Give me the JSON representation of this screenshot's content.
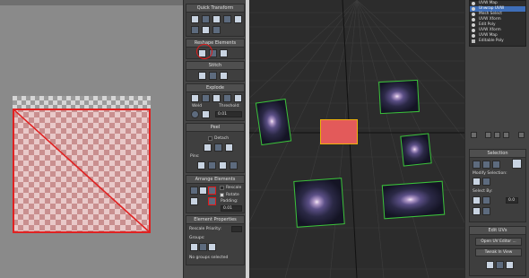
{
  "uv_editor": {
    "quick_transform": {
      "title": "Quick Transform"
    },
    "reshape_elements": {
      "title": "Reshape Elements"
    },
    "stitch": {
      "title": "Stitch"
    },
    "explode": {
      "title": "Explode",
      "weld_label": "Weld",
      "threshold_label": "Threshold:",
      "threshold_value": "0.01"
    },
    "peel": {
      "title": "Peel",
      "detach_label": "Detach",
      "pins_label": "Pins:"
    },
    "arrange": {
      "title": "Arrange Elements",
      "rescale_label": "Rescale",
      "rotate_label": "Rotate",
      "padding_label": "Padding:",
      "padding_value": "0.01"
    },
    "element_props": {
      "title": "Element Properties",
      "rescale_priority_label": "Rescale Priority:",
      "groups_label": "Groups:",
      "status": "No groups selected"
    }
  },
  "modifier_stack": {
    "items": [
      {
        "label": "UVW Map",
        "selected": false,
        "sub": false
      },
      {
        "label": "Unwrap UVW",
        "selected": true,
        "sub": false
      },
      {
        "label": "Mesh Select",
        "selected": false,
        "sub": false
      },
      {
        "label": "UVW Xform",
        "selected": false,
        "sub": false
      },
      {
        "label": "Edit Poly",
        "selected": false,
        "sub": false
      },
      {
        "label": "UVW Xform",
        "selected": false,
        "sub": false
      },
      {
        "label": "UVW Map",
        "selected": false,
        "sub": false
      },
      {
        "label": "Editable Poly",
        "selected": false,
        "sub": false
      }
    ]
  },
  "selection_panel": {
    "title": "Selection",
    "modify_selection_label": "Modify Selection:",
    "select_by_label": "Select By:",
    "select_by_value": "0.0"
  },
  "edit_uvs_panel": {
    "title": "Edit UVs",
    "open_uv_editor_label": "Open UV Editor ...",
    "tweak_in_view_label": "Tweak In View"
  },
  "colors": {
    "accent_selection": "#f0b20b",
    "uv_edge": "#e02222",
    "wire": "#3ac23a",
    "stack_highlight": "#3e6eb8"
  },
  "icons": [
    "unfold-icon",
    "mapping-icon",
    "pin-icon",
    "detach-icon",
    "pack-icon",
    "eye-icon",
    "open-editor-icon"
  ]
}
